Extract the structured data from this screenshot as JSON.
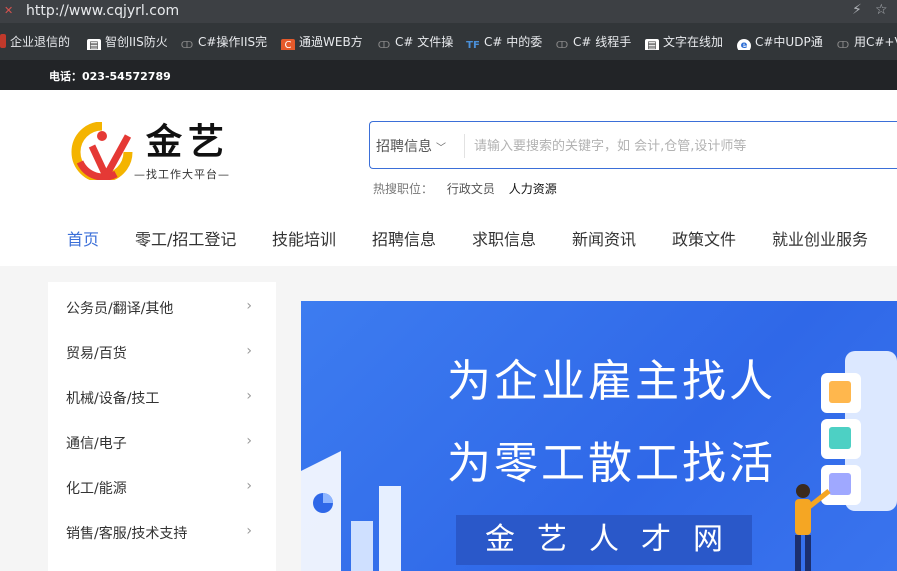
{
  "browser": {
    "url": "http://www.cqjyrl.com",
    "bookmarks": [
      {
        "label": "企业退信的",
        "icon": "bookmark-icon"
      },
      {
        "label": "智创IIS防火",
        "icon": "page-icon"
      },
      {
        "label": "C#操作IIS完",
        "icon": "bookmark-icon"
      },
      {
        "label": "通過WEB方",
        "icon": "c-icon"
      },
      {
        "label": "C# 文件操",
        "icon": "bookmark-icon"
      },
      {
        "label": "C# 中的委",
        "icon": "tf-icon"
      },
      {
        "label": "C# 线程手",
        "icon": "bookmark-icon"
      },
      {
        "label": "文字在线加",
        "icon": "page-icon"
      },
      {
        "label": "C#中UDP通",
        "icon": "globe-icon"
      },
      {
        "label": "用C#+V",
        "icon": "bookmark-icon"
      }
    ]
  },
  "topbar": {
    "phone": "电话：023-54572789"
  },
  "logo": {
    "title": "金艺",
    "subtitle": "—找工作大平台—"
  },
  "search": {
    "category": "招聘信息",
    "placeholder": "请输入要搜索的关键字，如 会计,仓管,设计师等",
    "hot_label": "热搜职位：",
    "hot_items": [
      "行政文员",
      "人力资源"
    ]
  },
  "nav": {
    "items": [
      "首页",
      "零工/招工登记",
      "技能培训",
      "招聘信息",
      "求职信息",
      "新闻资讯",
      "政策文件",
      "就业创业服务"
    ]
  },
  "sidebar": {
    "items": [
      "公务员/翻译/其他",
      "贸易/百货",
      "机械/设备/技工",
      "通信/电子",
      "化工/能源",
      "销售/客服/技术支持"
    ]
  },
  "banner": {
    "line1": "为企业雇主找人",
    "line2": "为零工散工找活",
    "brand": "金艺人才网"
  },
  "colors": {
    "accent": "#3b6fd8",
    "banner": "#2f68e8"
  }
}
